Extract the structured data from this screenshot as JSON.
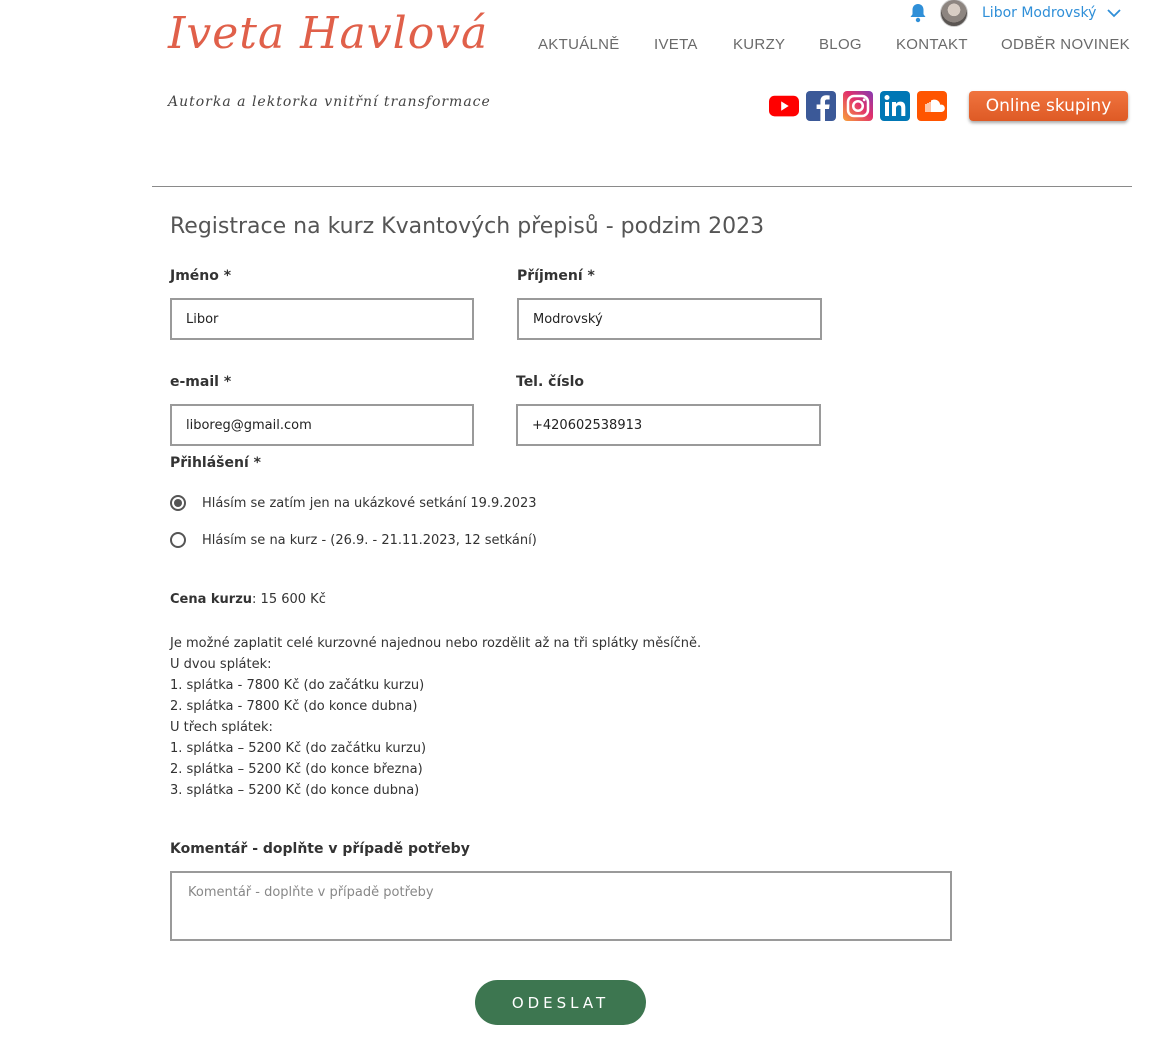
{
  "header": {
    "logo": "Iveta Havlová",
    "tagline": "Autorka a lektorka vnitřní transformace",
    "user_name": "Libor Modrovský",
    "nav": [
      "AKTUÁLNĚ",
      "IVETA",
      "KURZY",
      "BLOG",
      "KONTAKT",
      "ODBĚR NOVINEK"
    ],
    "social": [
      {
        "icon": "youtube-icon",
        "color": "#ff0000"
      },
      {
        "icon": "facebook-icon",
        "color": "#3b5998"
      },
      {
        "icon": "instagram-icon",
        "color": "#c13584"
      },
      {
        "icon": "linkedin-icon",
        "color": "#0077b5"
      },
      {
        "icon": "soundcloud-icon",
        "color": "#ff5500"
      }
    ],
    "cta_label": "Online skupiny"
  },
  "form": {
    "title": "Registrace na kurz Kvantových přepisů - podzim 2023",
    "first_name": {
      "label": "Jméno *",
      "value": "Libor"
    },
    "last_name": {
      "label": "Příjmení *",
      "value": "Modrovský"
    },
    "email": {
      "label": "e-mail *",
      "value": "liboreg@gmail.com"
    },
    "phone": {
      "label": "Tel. číslo",
      "value": "+420602538913"
    },
    "signup": {
      "label": "Přihlášení *",
      "options": [
        {
          "text": "Hlásím se zatím jen na ukázkové setkání 19.9.2023",
          "selected": true
        },
        {
          "text": "Hlásím se na kurz - (26.9. - 21.11.2023, 12 setkání)",
          "selected": false
        }
      ]
    },
    "price_label": "Cena kurzu",
    "price_value": ": 15 600 Kč",
    "info_lines": [
      "Je možné zaplatit celé kurzovné najednou nebo rozdělit až na tři splátky měsíčně.",
      "U dvou splátek:",
      "1. splátka - 7800 Kč (do začátku kurzu)",
      "2. splátka - 7800 Kč (do konce dubna)",
      "U třech splátek:",
      "1. splátka – 5200 Kč (do začátku kurzu)",
      "2. splátka – 5200 Kč (do konce března)",
      "3. splátka – 5200 Kč (do konce dubna)"
    ],
    "comment": {
      "label": "Komentář - doplňte v případě potřeby",
      "placeholder": "Komentář - doplňte v případě potřeby"
    },
    "submit_label": "ODESLAT"
  },
  "colors": {
    "accent": "#e0604a",
    "submit": "#3d7650",
    "user_link": "#2f8fd8"
  }
}
